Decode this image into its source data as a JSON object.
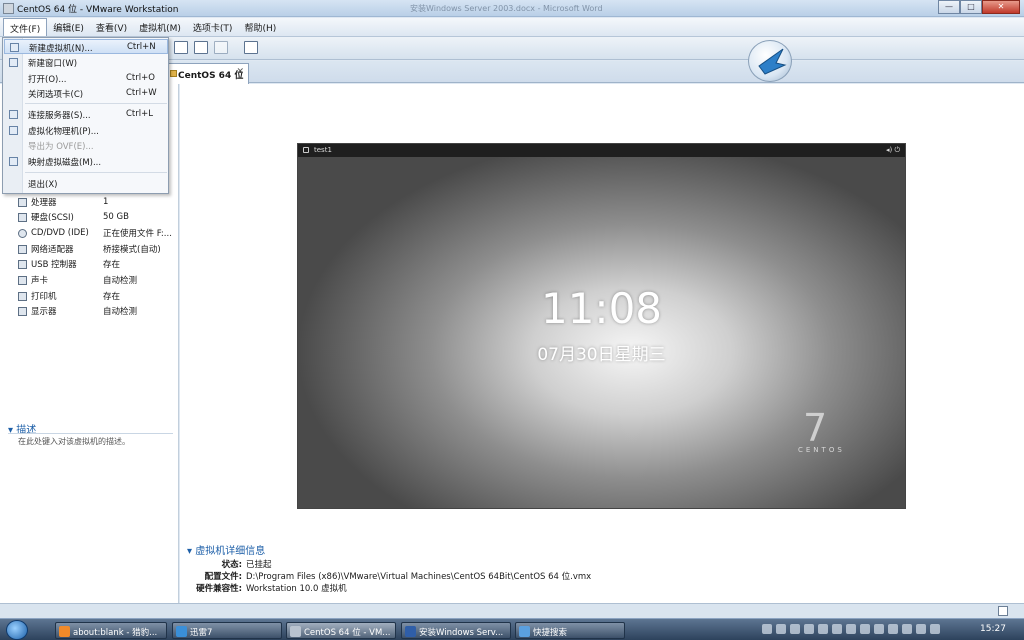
{
  "window": {
    "title": "CentOS 64 位 - VMware Workstation",
    "ghost_title": "安装Windows Server 2003.docx - Microsoft Word",
    "controls": {
      "minimize": "—",
      "maximize": "□",
      "close": "✕"
    }
  },
  "menubar": [
    "文件(F)",
    "编辑(E)",
    "查看(V)",
    "虚拟机(M)",
    "选项卡(T)",
    "帮助(H)"
  ],
  "file_menu": {
    "items": [
      {
        "label": "新建虚拟机(N)...",
        "shortcut": "Ctrl+N",
        "highlighted": true
      },
      {
        "label": "新建窗口(W)",
        "shortcut": ""
      },
      {
        "label": "打开(O)...",
        "shortcut": "Ctrl+O"
      },
      {
        "label": "关闭选项卡(C)",
        "shortcut": "Ctrl+W"
      },
      {
        "label": "连接服务器(S)...",
        "shortcut": "Ctrl+L"
      },
      {
        "label": "虚拟化物理机(P)...",
        "shortcut": ""
      },
      {
        "label": "导出为 OVF(E)...",
        "shortcut": "",
        "disabled": true
      },
      {
        "label": "映射虚拟磁盘(M)...",
        "shortcut": ""
      },
      {
        "label": "退出(X)",
        "shortcut": ""
      }
    ]
  },
  "tab": {
    "label": "CentOS 64 位",
    "close": "✕"
  },
  "devices": [
    {
      "name": "处理器",
      "value": "1"
    },
    {
      "name": "硬盘(SCSI)",
      "value": "50 GB"
    },
    {
      "name": "CD/DVD (IDE)",
      "value": "正在使用文件 F:..."
    },
    {
      "name": "网络适配器",
      "value": "桥接模式(自动)"
    },
    {
      "name": "USB 控制器",
      "value": "存在"
    },
    {
      "name": "声卡",
      "value": "自动检测"
    },
    {
      "name": "打印机",
      "value": "存在"
    },
    {
      "name": "显示器",
      "value": "自动检测"
    }
  ],
  "description": {
    "heading": "描述",
    "placeholder": "在此处键入对该虚拟机的描述。"
  },
  "guest": {
    "username": "test1",
    "clock": "11:08",
    "date": "07月30日星期三",
    "brand_number": "7",
    "brand_name": "CENTOS"
  },
  "details": {
    "heading": "虚拟机详细信息",
    "rows": [
      {
        "key": "状态:",
        "value": "已挂起"
      },
      {
        "key": "配置文件:",
        "value": "D:\\Program Files (x86)\\VMware\\Virtual Machines\\CentOS 64Bit\\CentOS 64 位.vmx"
      },
      {
        "key": "硬件兼容性:",
        "value": "Workstation 10.0 虚拟机"
      }
    ]
  },
  "taskbar": {
    "tasks": [
      {
        "label": "about:blank - 猎豹...",
        "color": "#f08a2a"
      },
      {
        "label": "迅雷7",
        "color": "#3a8fd8"
      },
      {
        "label": "CentOS 64 位 - VM...",
        "color": "#b9c3cf"
      },
      {
        "label": "安装Windows Serv...",
        "color": "#2f5ea8"
      },
      {
        "label": "快捷搜索",
        "color": "#5aa0e0"
      }
    ],
    "time": "15:27"
  },
  "colors": {
    "accent": "#1d5fa8",
    "menu_highlight": "#cfe0f5"
  }
}
